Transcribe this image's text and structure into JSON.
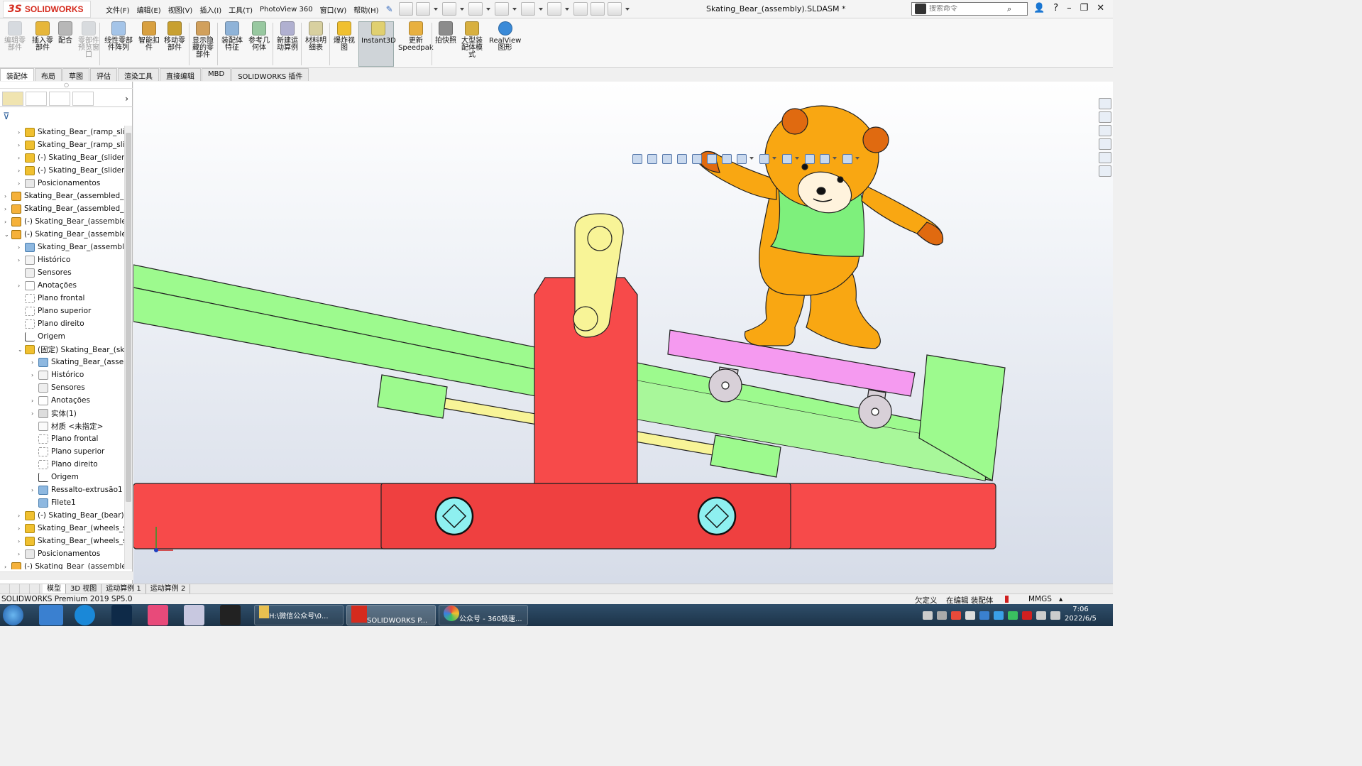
{
  "app": {
    "logo_ds": "3S",
    "logo_name": "SOLIDWORKS",
    "document_title": "Skating_Bear_(assembly).SLDASM *"
  },
  "menu": [
    "文件(F)",
    "编辑(E)",
    "视图(V)",
    "插入(I)",
    "工具(T)",
    "PhotoView 360",
    "窗口(W)",
    "帮助(H)"
  ],
  "search": {
    "placeholder": "搜索命令"
  },
  "ribbon": [
    {
      "label": "编辑零\n部件",
      "disabled": true,
      "color": "#9aa6b4"
    },
    {
      "label": "插入零\n部件",
      "disabled": false,
      "color": "#e6b63a"
    },
    {
      "label": "配合",
      "disabled": false,
      "color": "#b7b7b7"
    },
    {
      "label": "零部件\n预览窗\n口",
      "disabled": true,
      "color": "#a0a8b2"
    },
    {
      "label": "线性零部\n件阵列",
      "disabled": false,
      "color": "#a4c4e8"
    },
    {
      "label": "智能扣\n件",
      "disabled": false,
      "color": "#d8a040"
    },
    {
      "label": "移动零\n部件",
      "disabled": false,
      "color": "#c8a030"
    },
    {
      "label": "显示隐\n藏的零\n部件",
      "disabled": false,
      "color": "#d1a05c"
    },
    {
      "label": "装配体\n特征",
      "disabled": false,
      "color": "#8fb3d8"
    },
    {
      "label": "参考几\n何体",
      "disabled": false,
      "color": "#98c8a0"
    },
    {
      "label": "新建运\n动算例",
      "disabled": false,
      "color": "#b0b0d0"
    },
    {
      "label": "材料明\n细表",
      "disabled": false,
      "color": "#d8d0a0"
    },
    {
      "label": "爆炸视\n图",
      "disabled": false,
      "color": "#f0c030"
    },
    {
      "label": "Instant3D",
      "disabled": false,
      "color": "#e0d070"
    },
    {
      "label": "更新\nSpeedpak",
      "disabled": false,
      "color": "#e8b040"
    },
    {
      "label": "拍快照",
      "disabled": false,
      "color": "#8c8c8c"
    },
    {
      "label": "大型装\n配体模\n式",
      "disabled": false,
      "color": "#d8b040"
    },
    {
      "label": "RealView\n图形",
      "disabled": false,
      "color": "#3a8ad8"
    }
  ],
  "command_tabs": [
    "装配体",
    "布局",
    "草图",
    "评估",
    "渲染工具",
    "直接编辑",
    "MBD",
    "SOLIDWORKS 插件"
  ],
  "tree": [
    {
      "indent": 1,
      "arrow": "›",
      "icon": "part",
      "label": "Skating_Bear_(ramp_slic"
    },
    {
      "indent": 1,
      "arrow": "›",
      "icon": "part",
      "label": "Skating_Bear_(ramp_slic"
    },
    {
      "indent": 1,
      "arrow": "›",
      "icon": "part",
      "label": "(-) Skating_Bear_(slider_"
    },
    {
      "indent": 1,
      "arrow": "›",
      "icon": "part",
      "label": "(-) Skating_Bear_(slider_"
    },
    {
      "indent": 1,
      "arrow": "›",
      "icon": "mate",
      "label": "Posicionamentos"
    },
    {
      "indent": 0,
      "arrow": "›",
      "icon": "asm",
      "label": "Skating_Bear_(assembled_in"
    },
    {
      "indent": 0,
      "arrow": "›",
      "icon": "asm",
      "label": "Skating_Bear_(assembled_sl"
    },
    {
      "indent": 0,
      "arrow": "›",
      "icon": "asm",
      "label": "(-) Skating_Bear_(assemblec"
    },
    {
      "indent": 0,
      "arrow": "⌄",
      "icon": "asm",
      "label": "(-) Skating_Bear_(assemblec"
    },
    {
      "indent": 1,
      "arrow": "›",
      "icon": "feat",
      "label": "Skating_Bear_(assembly"
    },
    {
      "indent": 1,
      "arrow": "›",
      "icon": "hist",
      "label": "Histórico"
    },
    {
      "indent": 1,
      "arrow": "",
      "icon": "sens",
      "label": "Sensores"
    },
    {
      "indent": 1,
      "arrow": "›",
      "icon": "ann",
      "label": "Anotações"
    },
    {
      "indent": 1,
      "arrow": "",
      "icon": "plane",
      "label": "Plano frontal"
    },
    {
      "indent": 1,
      "arrow": "",
      "icon": "plane",
      "label": "Plano superior"
    },
    {
      "indent": 1,
      "arrow": "",
      "icon": "plane",
      "label": "Plano direito"
    },
    {
      "indent": 1,
      "arrow": "",
      "icon": "orig",
      "label": "Origem"
    },
    {
      "indent": 1,
      "arrow": "⌄",
      "icon": "part",
      "label": "(固定) Skating_Bear_(ska"
    },
    {
      "indent": 2,
      "arrow": "›",
      "icon": "feat",
      "label": "Skating_Bear_(asser"
    },
    {
      "indent": 2,
      "arrow": "›",
      "icon": "hist",
      "label": "Histórico"
    },
    {
      "indent": 2,
      "arrow": "",
      "icon": "sens",
      "label": "Sensores"
    },
    {
      "indent": 2,
      "arrow": "›",
      "icon": "ann",
      "label": "Anotações"
    },
    {
      "indent": 2,
      "arrow": "›",
      "icon": "body",
      "label": "实体(1)"
    },
    {
      "indent": 2,
      "arrow": "",
      "icon": "mat",
      "label": "材质 <未指定>"
    },
    {
      "indent": 2,
      "arrow": "",
      "icon": "plane",
      "label": "Plano frontal"
    },
    {
      "indent": 2,
      "arrow": "",
      "icon": "plane",
      "label": "Plano superior"
    },
    {
      "indent": 2,
      "arrow": "",
      "icon": "plane",
      "label": "Plano direito"
    },
    {
      "indent": 2,
      "arrow": "",
      "icon": "orig",
      "label": "Origem"
    },
    {
      "indent": 2,
      "arrow": "›",
      "icon": "feat",
      "label": "Ressalto-extrusão1"
    },
    {
      "indent": 2,
      "arrow": "",
      "icon": "feat",
      "label": "Filete1"
    },
    {
      "indent": 1,
      "arrow": "›",
      "icon": "part",
      "label": "(-) Skating_Bear_(bear)<"
    },
    {
      "indent": 1,
      "arrow": "›",
      "icon": "part",
      "label": "Skating_Bear_(wheels_su"
    },
    {
      "indent": 1,
      "arrow": "›",
      "icon": "part",
      "label": "Skating_Bear_(wheels_su"
    },
    {
      "indent": 1,
      "arrow": "›",
      "icon": "mate",
      "label": "Posicionamentos"
    },
    {
      "indent": 0,
      "arrow": "›",
      "icon": "asm",
      "label": "(-) Skating_Bear_(assemblec"
    }
  ],
  "bottom_tabs": [
    "模型",
    "3D 视图",
    "运动算例 1",
    "运动算例 2"
  ],
  "status": {
    "left": "SOLIDWORKS Premium 2019 SP5.0",
    "state1": "欠定义",
    "state2": "在编辑 装配体",
    "units": "MMGS"
  },
  "taskbar": {
    "items": [
      {
        "label": "H:\\微信公众号\\0...",
        "color": "#e8c050"
      },
      {
        "label": "SOLIDWORKS P...",
        "color": "#d52b1e"
      },
      {
        "label": "公众号 - 360极速...",
        "color": "#3aa0e8"
      }
    ],
    "time": "7:06",
    "date": "2022/6/5"
  },
  "scene_colors": {
    "rail": "#9dfa8e",
    "base": "#f74a4a",
    "link": "#f8f497",
    "board": "#f59af0",
    "bear_body": "#f9a712",
    "bear_shirt": "#7ef07c",
    "bear_ear": "#e06a10",
    "wheel": "#d8d0d8",
    "pin": "#8ef0f0"
  }
}
